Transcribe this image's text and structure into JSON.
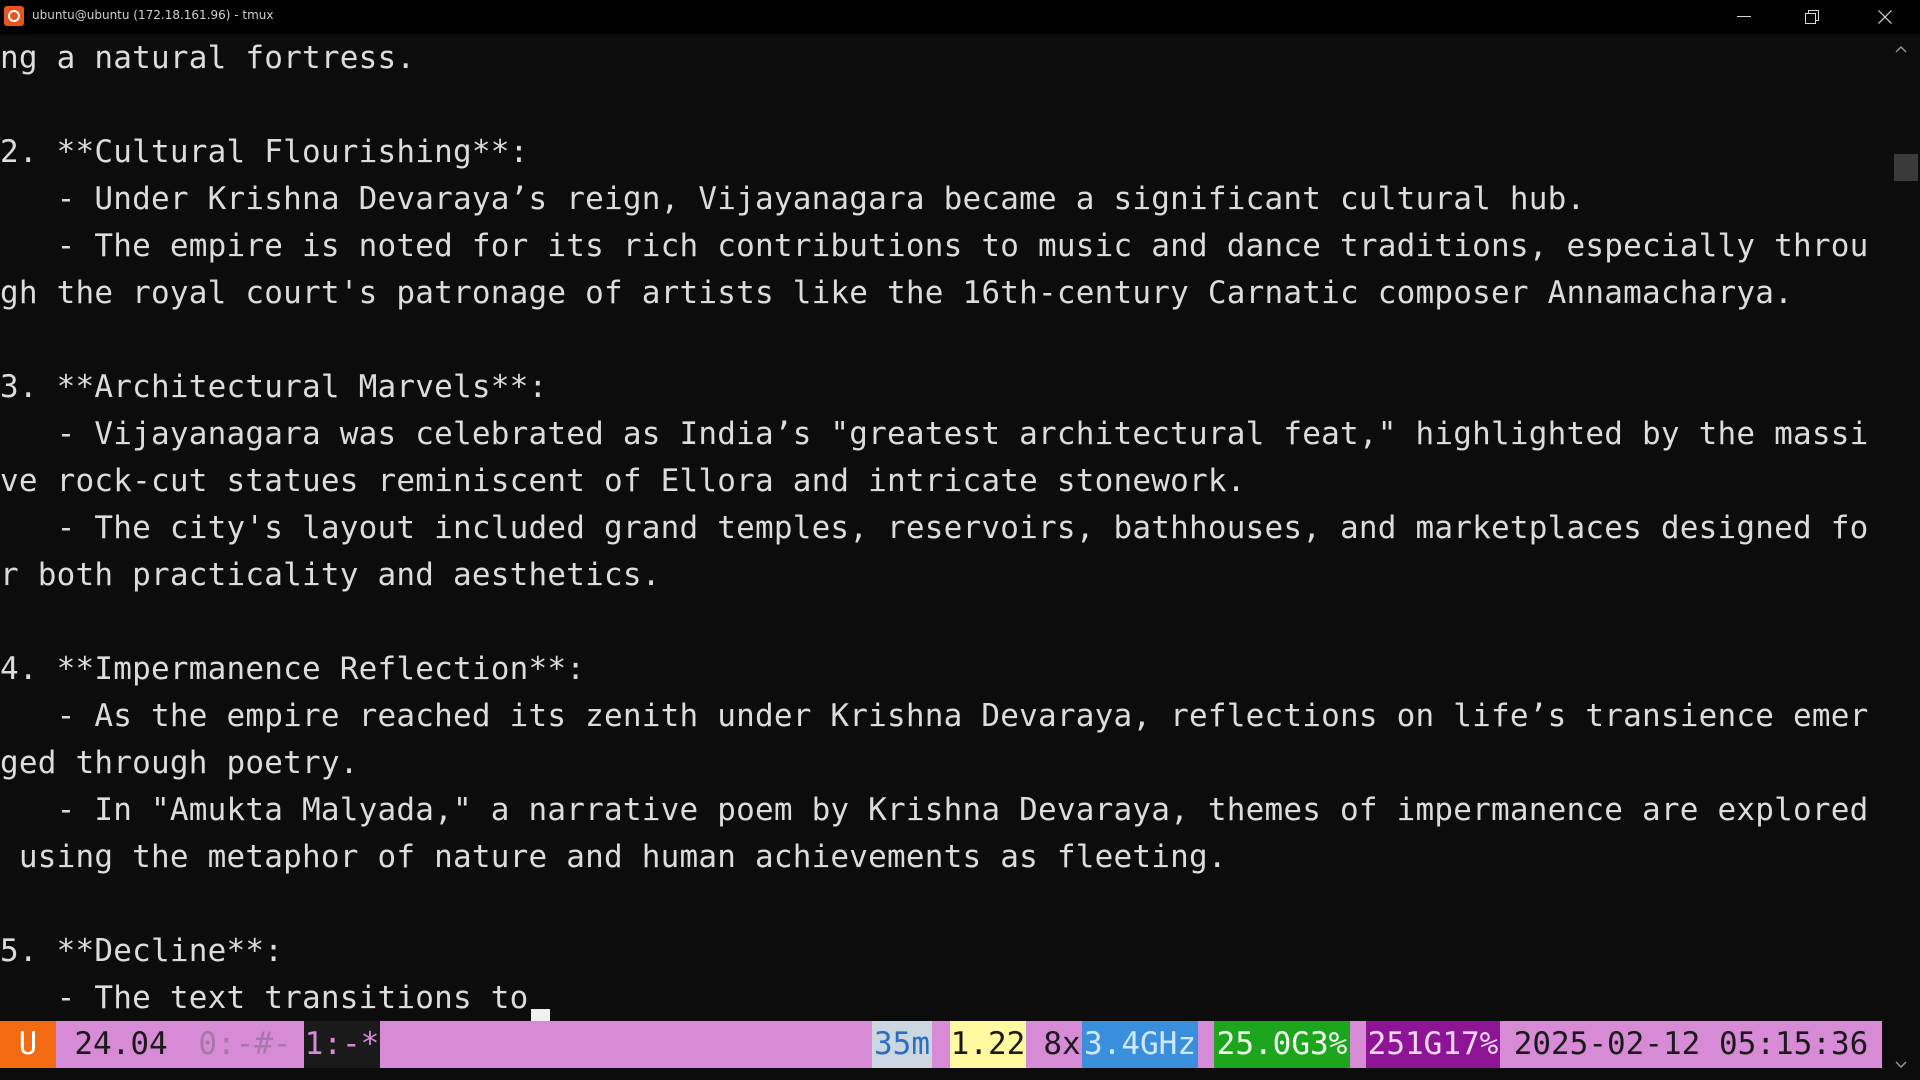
{
  "window": {
    "title": "ubuntu@ubuntu (172.18.161.96) - tmux",
    "minimize_label": "—",
    "close_label": "✕"
  },
  "terminal": {
    "lines": [
      "ng a natural fortress.",
      "",
      "2. **Cultural Flourishing**:",
      "   - Under Krishna Devaraya’s reign, Vijayanagara became a significant cultural hub.",
      "   - The empire is noted for its rich contributions to music and dance traditions, especially throu",
      "gh the royal court's patronage of artists like the 16th-century Carnatic composer Annamacharya.",
      "",
      "3. **Architectural Marvels**:",
      "   - Vijayanagara was celebrated as India’s \"greatest architectural feat,\" highlighted by the massi",
      "ve rock-cut statues reminiscent of Ellora and intricate stonework.",
      "   - The city's layout included grand temples, reservoirs, bathhouses, and marketplaces designed fo",
      "r both practicality and aesthetics.",
      "",
      "4. **Impermanence Reflection**:",
      "   - As the empire reached its zenith under Krishna Devaraya, reflections on life’s transience emer",
      "ged through poetry.",
      "   - In \"Amukta Malyada,\" a narrative poem by Krishna Devaraya, themes of impermanence are explored",
      " using the metaphor of nature and human achievements as fleeting.",
      "",
      "5. **Decline**:",
      "   - The text transitions to"
    ]
  },
  "status": {
    "session": "U",
    "version": "24.04",
    "window_list": "0:-#-",
    "active_window": "1:-*",
    "uptime": "35m",
    "load": "1.22",
    "cpu_count": "8x",
    "cpu_freq": "3.4GHz",
    "memory": "25.0G3%",
    "disk": "251G17%",
    "datetime": "2025-02-12 05:15:36"
  },
  "colors": {
    "terminal_bg": "#0c0c0c",
    "terminal_fg": "#dcdcdc",
    "status_bg": "#d78bd7",
    "session_bg": "#f26a12",
    "cpu_freq_bg": "#3a8fdc",
    "memory_bg": "#1ea51e",
    "disk_bg": "#8e1496",
    "uptime_bg": "#cdd7e1",
    "load_bg": "#fffaa0"
  },
  "icons": {
    "app": "ubuntu-logo-icon",
    "minimize": "minimize-icon",
    "maximize": "restore-icon",
    "close": "close-icon",
    "scroll_up": "chevron-up-icon",
    "scroll_down": "chevron-down-icon"
  }
}
